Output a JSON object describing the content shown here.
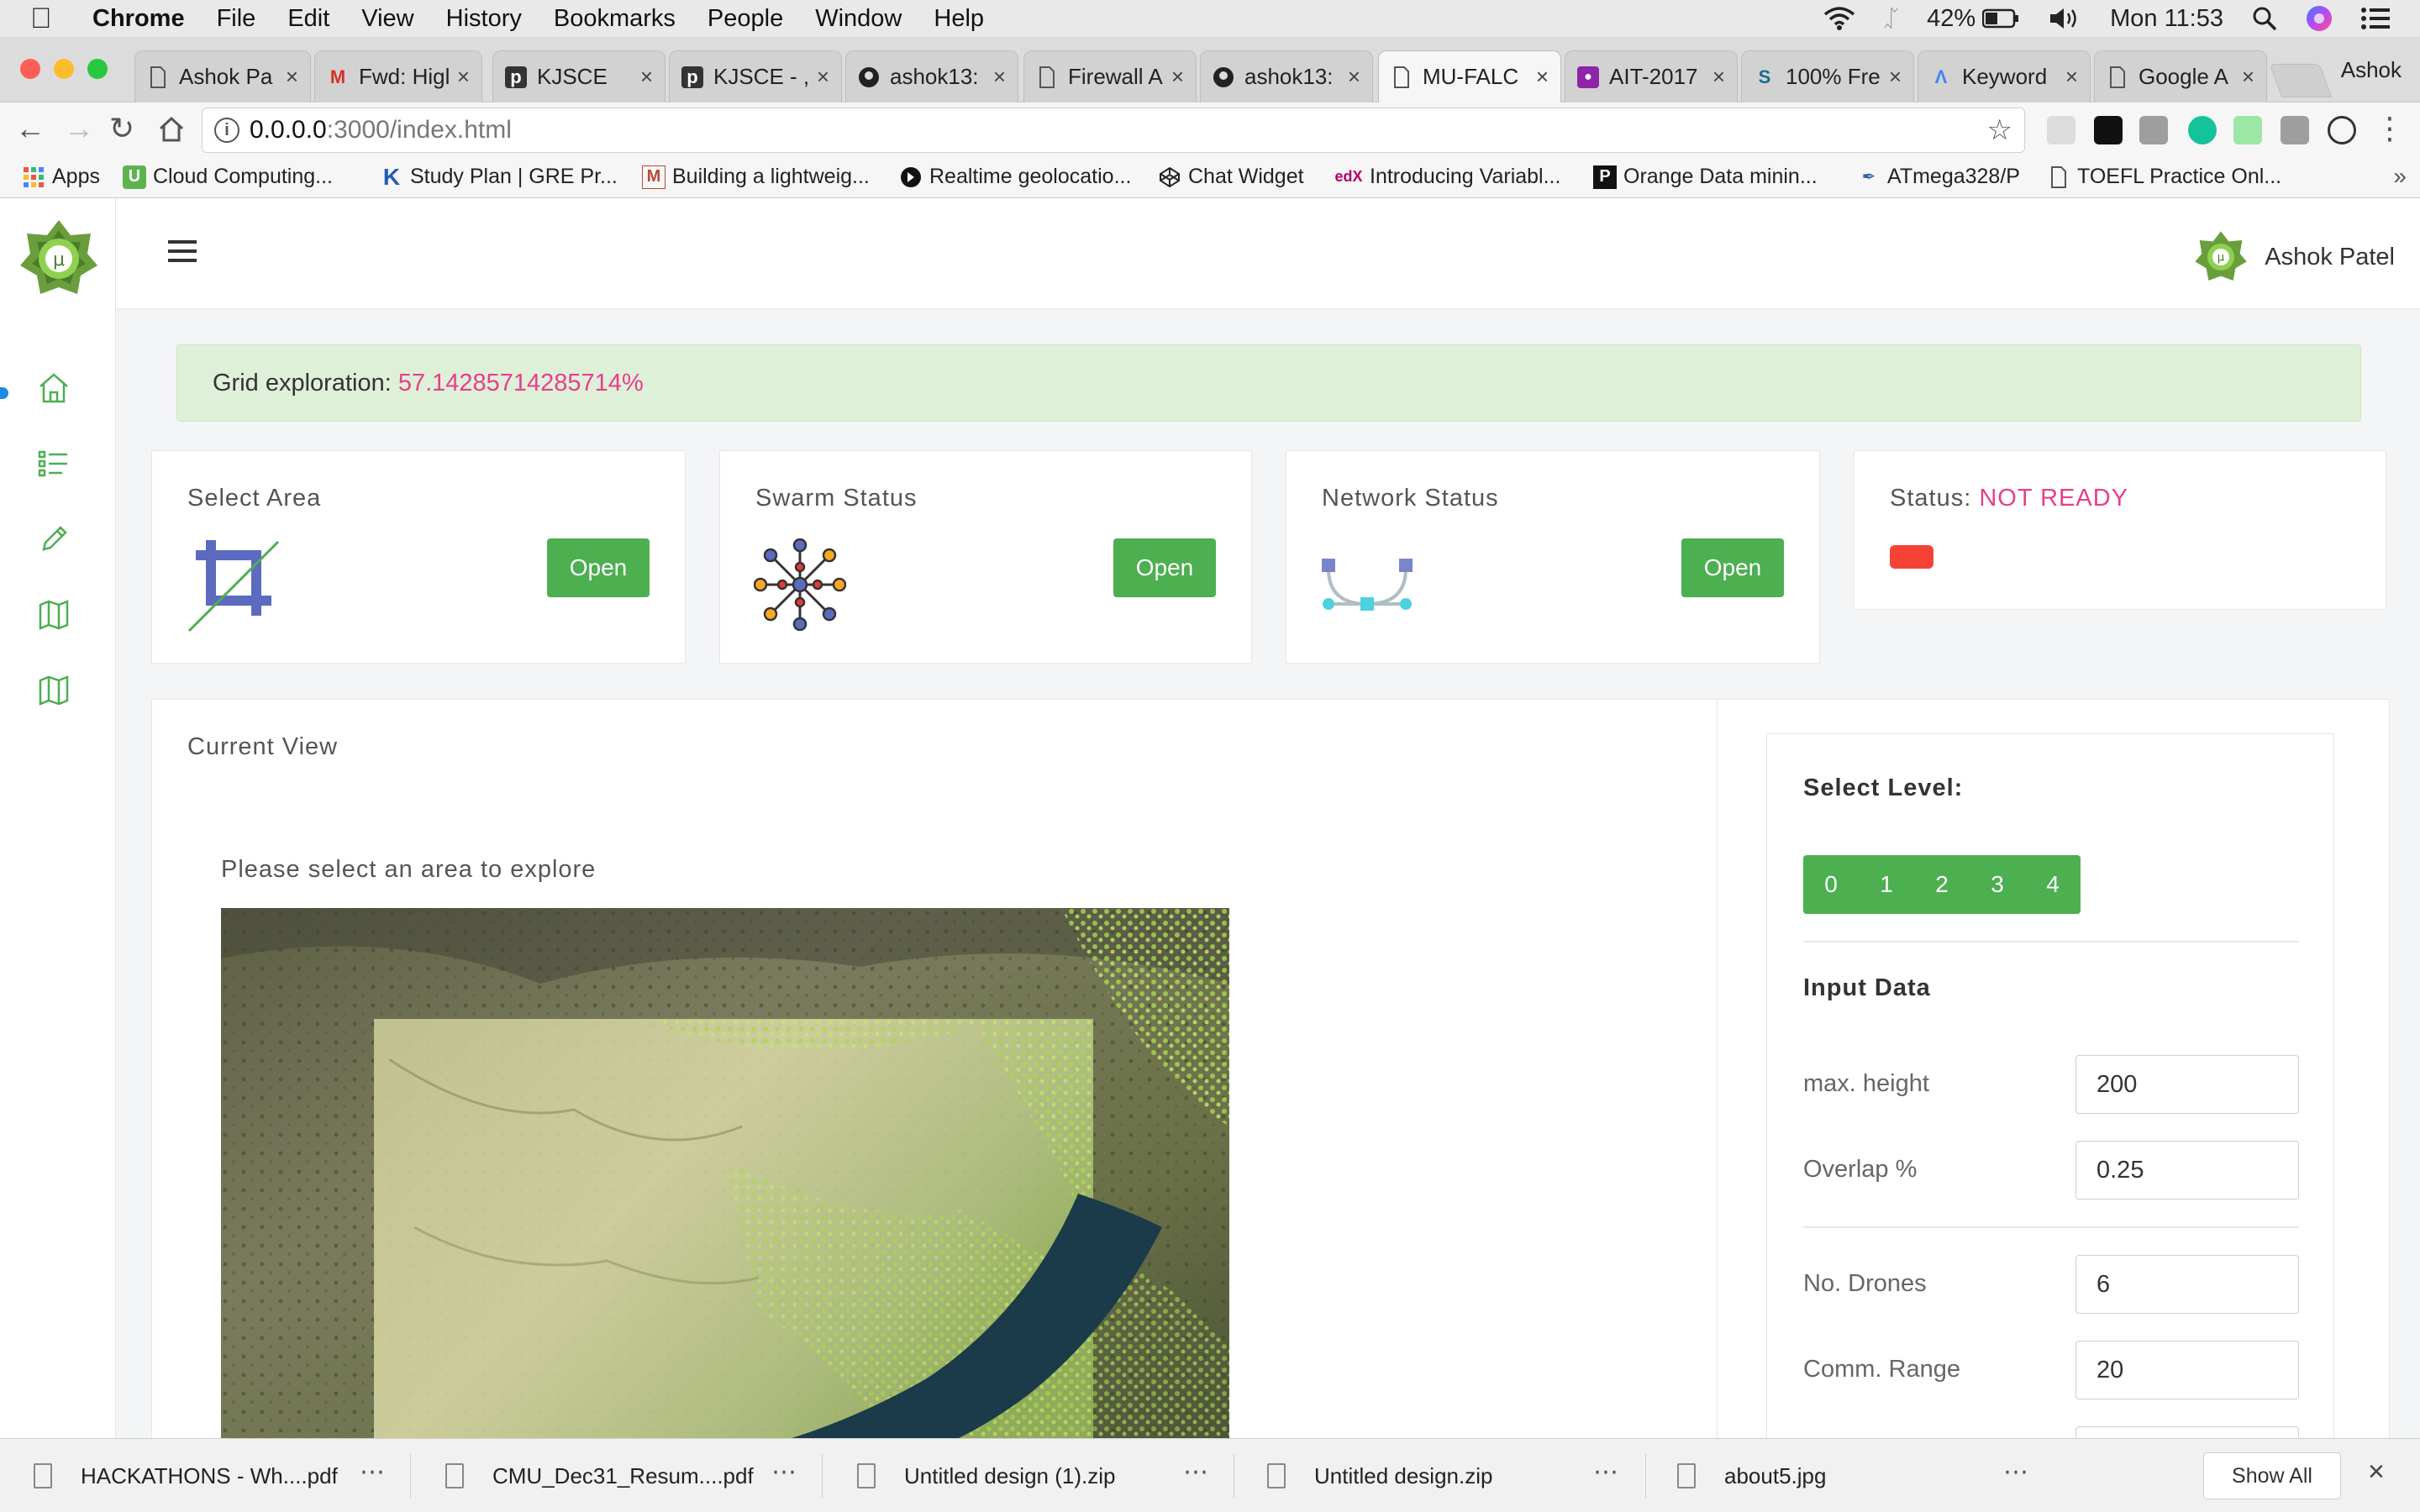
{
  "menubar": {
    "app": "Chrome",
    "items": [
      "File",
      "Edit",
      "View",
      "History",
      "Bookmarks",
      "People",
      "Window",
      "Help"
    ],
    "battery": "42%",
    "clock": "Mon 11:53"
  },
  "tabs": [
    {
      "title": "Ashok Pa",
      "icon": "doc"
    },
    {
      "title": "Fwd: Higl",
      "icon": "gmail"
    },
    {
      "title": "KJSCE",
      "icon": "p"
    },
    {
      "title": "KJSCE - ,",
      "icon": "p"
    },
    {
      "title": "ashok13:",
      "icon": "github"
    },
    {
      "title": "Firewall A",
      "icon": "doc"
    },
    {
      "title": "ashok13:",
      "icon": "github"
    },
    {
      "title": "MU-FALC",
      "icon": "doc"
    },
    {
      "title": "AIT-2017",
      "icon": "contact"
    },
    {
      "title": "100% Fre",
      "icon": "swirl"
    },
    {
      "title": "Keyword",
      "icon": "ads"
    },
    {
      "title": "Google A",
      "icon": "doc"
    }
  ],
  "profile_name": "Ashok",
  "url": {
    "host": "0.0.0.0",
    "rest": ":3000/index.html"
  },
  "bookmarks": [
    {
      "label": "Apps",
      "icon": "grid"
    },
    {
      "label": "Cloud Computing...",
      "icon": "U"
    },
    {
      "label": "Study Plan | GRE Pr...",
      "icon": "K"
    },
    {
      "label": "Building a lightweig...",
      "icon": "M"
    },
    {
      "label": "Realtime geolocatio...",
      "icon": "dark"
    },
    {
      "label": "Chat Widget",
      "icon": "codepen"
    },
    {
      "label": "Introducing Variabl...",
      "icon": "edx"
    },
    {
      "label": "Orange Data minin...",
      "icon": "P"
    },
    {
      "label": "ATmega328/P",
      "icon": "pen"
    },
    {
      "label": "TOEFL Practice Onl...",
      "icon": "doc"
    }
  ],
  "header": {
    "user_name": "Ashok Patel"
  },
  "alert": {
    "label": "Grid exploration: ",
    "value": "57.14285714285714%"
  },
  "cards": {
    "select_area": {
      "title": "Select Area",
      "button": "Open"
    },
    "swarm_status": {
      "title": "Swarm Status",
      "button": "Open"
    },
    "network_status": {
      "title": "Network Status",
      "button": "Open"
    },
    "status": {
      "label": "Status: ",
      "value": "NOT READY"
    }
  },
  "current_view": {
    "title": "Current View",
    "prompt": "Please select an area to explore"
  },
  "controls": {
    "select_level_label": "Select Level:",
    "levels": [
      "0",
      "1",
      "2",
      "3",
      "4"
    ],
    "input_data_title": "Input Data",
    "fields": [
      {
        "label": "max. height",
        "value": "200"
      },
      {
        "label": "Overlap %",
        "value": "0.25"
      },
      {
        "label": "No. Drones",
        "value": "6"
      },
      {
        "label": "Comm. Range",
        "value": "20"
      }
    ]
  },
  "downloads": [
    {
      "name": "HACKATHONS  - Wh....pdf"
    },
    {
      "name": "CMU_Dec31_Resum....pdf"
    },
    {
      "name": "Untitled design (1).zip"
    },
    {
      "name": "Untitled design.zip"
    },
    {
      "name": "about5.jpg"
    }
  ],
  "downloads_show_all": "Show All",
  "colors": {
    "brand_green": "#4caf50",
    "alert_bg": "#dff0d8",
    "alert_value": "#e83e8c",
    "status_red": "#f44336"
  }
}
